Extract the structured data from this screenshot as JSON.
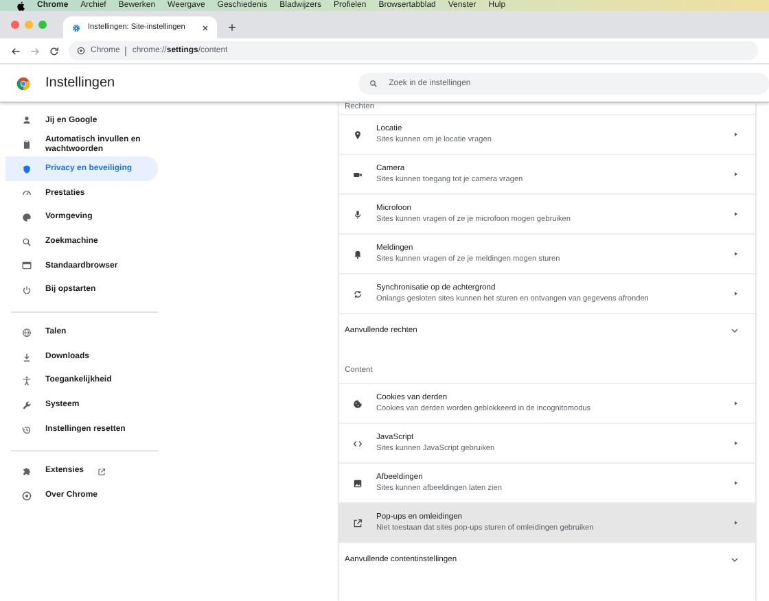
{
  "menubar": {
    "app": "Chrome",
    "items": [
      "Archief",
      "Bewerken",
      "Weergave",
      "Geschiedenis",
      "Bladwijzers",
      "Profielen",
      "Browsertabblad",
      "Venster",
      "Hulp"
    ]
  },
  "tabs": [
    {
      "title": "Instellingen: Site-instellingen",
      "selected": true
    }
  ],
  "address": {
    "site": "Chrome",
    "url_pre": "chrome://",
    "url_bold": "settings",
    "url_post": "/content"
  },
  "header": {
    "title": "Instellingen",
    "search": {
      "placeholder": "Zoek in de instellingen"
    }
  },
  "sidebar": {
    "groups": [
      [
        {
          "label": "Jij en Google",
          "selected": false
        },
        {
          "label": "Automatisch invullen en wachtwoorden",
          "selected": false
        },
        {
          "label": "Privacy en beveiliging",
          "selected": true
        },
        {
          "label": "Prestaties",
          "selected": false
        },
        {
          "label": "Vormgeving",
          "selected": false
        },
        {
          "label": "Zoekmachine",
          "selected": false
        },
        {
          "label": "Standaardbrowser",
          "selected": false
        },
        {
          "label": "Bij opstarten",
          "selected": false
        }
      ],
      [
        {
          "label": "Talen",
          "selected": false
        },
        {
          "label": "Downloads",
          "selected": false
        },
        {
          "label": "Toegankelijkheid",
          "selected": false
        },
        {
          "label": "Systeem",
          "selected": false
        },
        {
          "label": "Instellingen resetten",
          "selected": false
        }
      ],
      [
        {
          "label": "Extensies",
          "selected": false,
          "external": true
        },
        {
          "label": "Over Chrome",
          "selected": false,
          "external": false
        }
      ]
    ]
  },
  "sections": [
    {
      "heading": "Rechten",
      "rows": [
        {
          "title": "Locatie",
          "subtitle": "Sites kunnen om je locatie vragen",
          "highlighted": false
        },
        {
          "title": "Camera",
          "subtitle": "Sites kunnen toegang tot je camera vragen",
          "highlighted": false
        },
        {
          "title": "Microfoon",
          "subtitle": "Sites kunnen vragen of ze je microfoon mogen gebruiken",
          "highlighted": false
        },
        {
          "title": "Meldingen",
          "subtitle": "Sites kunnen vragen of ze je meldingen mogen sturen",
          "highlighted": false
        },
        {
          "title": "Synchronisatie op de achtergrond",
          "subtitle": "Onlangs gesloten sites kunnen het sturen en ontvangen van gegevens afronden",
          "highlighted": false
        }
      ],
      "more": "Aanvullende rechten"
    },
    {
      "heading": "Content",
      "rows": [
        {
          "title": "Cookies van derden",
          "subtitle": "Cookies van derden worden geblokkeerd in de incognitomodus",
          "highlighted": false
        },
        {
          "title": "JavaScript",
          "subtitle": "Sites kunnen JavaScript gebruiken",
          "highlighted": false
        },
        {
          "title": "Afbeeldingen",
          "subtitle": "Sites kunnen afbeeldingen laten zien",
          "highlighted": false
        },
        {
          "title": "Pop-ups en omleidingen",
          "subtitle": "Niet toestaan dat sites pop-ups sturen of omleidingen gebruiken",
          "highlighted": true
        }
      ],
      "more": "Aanvullende contentinstellingen"
    }
  ]
}
